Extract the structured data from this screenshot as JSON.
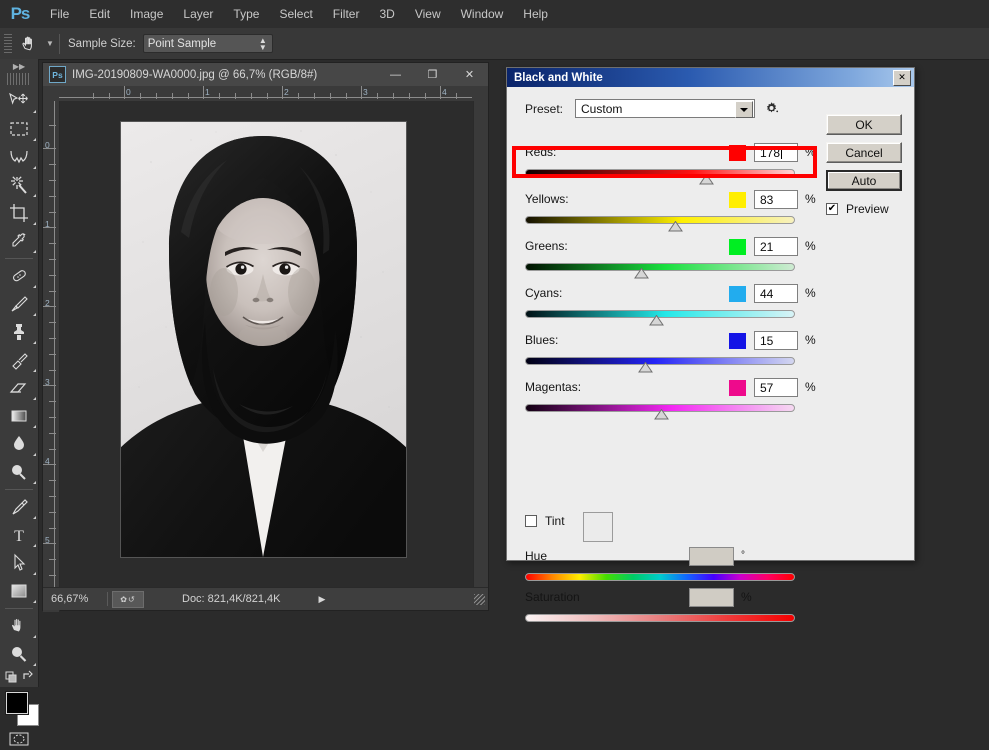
{
  "app": {
    "logo": "Ps",
    "menus": [
      "File",
      "Edit",
      "Image",
      "Layer",
      "Type",
      "Select",
      "Filter",
      "3D",
      "View",
      "Window",
      "Help"
    ]
  },
  "options_bar": {
    "tool_icon": "hand-tool-icon",
    "sample_size_label": "Sample Size:",
    "sample_size_value": "Point Sample"
  },
  "toolbar": {
    "tools": [
      {
        "name": "move-tool",
        "has_submenu": true
      },
      {
        "name": "rectangular-marquee-tool",
        "has_submenu": true
      },
      {
        "name": "lasso-tool",
        "has_submenu": true
      },
      {
        "name": "magic-wand-tool",
        "has_submenu": true
      },
      {
        "name": "crop-tool",
        "has_submenu": true
      },
      {
        "name": "eyedropper-tool",
        "has_submenu": true
      },
      {
        "name": "spot-healing-brush-tool",
        "has_submenu": true
      },
      {
        "name": "brush-tool",
        "has_submenu": true
      },
      {
        "name": "clone-stamp-tool",
        "has_submenu": true
      },
      {
        "name": "history-brush-tool",
        "has_submenu": true
      },
      {
        "name": "eraser-tool",
        "has_submenu": true
      },
      {
        "name": "gradient-tool",
        "has_submenu": true
      },
      {
        "name": "blur-tool",
        "has_submenu": true
      },
      {
        "name": "dodge-tool",
        "has_submenu": true
      },
      {
        "name": "pen-tool",
        "has_submenu": true
      },
      {
        "name": "horizontal-type-tool",
        "has_submenu": true
      },
      {
        "name": "path-selection-tool",
        "has_submenu": true
      },
      {
        "name": "rectangle-tool",
        "has_submenu": true
      },
      {
        "name": "hand-tool",
        "has_submenu": true
      },
      {
        "name": "zoom-tool",
        "has_submenu": true
      }
    ],
    "foreground_color": "#000000",
    "background_color": "#ffffff"
  },
  "document": {
    "title": "IMG-20190809-WA0000.jpg @ 66,7% (RGB/8#)",
    "icon": "Ps",
    "window_buttons": {
      "minimize": "—",
      "maximize": "❐",
      "close": "✕"
    },
    "ruler_h_marks": [
      "0",
      "1",
      "2",
      "3",
      "4"
    ],
    "ruler_v_marks": [
      "0",
      "1",
      "2",
      "3",
      "4",
      "5"
    ],
    "status": {
      "zoom": "66,67%",
      "doc_size": "Doc: 821,4K/821,4K",
      "arrow": "▶"
    },
    "image_description": "black-and-white-portrait-photo"
  },
  "dialog": {
    "title": "Black and White",
    "close_label": "✕",
    "preset_label": "Preset:",
    "preset_value": "Custom",
    "gear_icon": "gear-options-icon",
    "buttons": {
      "ok": "OK",
      "cancel": "Cancel",
      "auto": "Auto"
    },
    "preview": {
      "label": "Preview",
      "checked": true,
      "check_glyph": "✔"
    },
    "channels": [
      {
        "label": "Reds:",
        "value": "178",
        "unit": "%",
        "swatch": "#ff0000",
        "thumb_pct": 66.5,
        "from": "#100000",
        "mid": "#ff1414",
        "to": "#ffd4d4",
        "focused": true
      },
      {
        "label": "Yellows:",
        "value": "83",
        "unit": "%",
        "swatch": "#ffee00",
        "thumb_pct": 55.0,
        "from": "#121000",
        "mid": "#fff000",
        "to": "#fbf5c8",
        "focused": false
      },
      {
        "label": "Greens:",
        "value": "21",
        "unit": "%",
        "swatch": "#00ee22",
        "thumb_pct": 42.5,
        "from": "#001200",
        "mid": "#15e23c",
        "to": "#cdecd2",
        "focused": false
      },
      {
        "label": "Cyans:",
        "value": "44",
        "unit": "%",
        "swatch": "#22acee",
        "thumb_pct": 48.0,
        "from": "#001013",
        "mid": "#22e8e8",
        "to": "#d6f3f6",
        "focused": false
      },
      {
        "label": "Blues:",
        "value": "15",
        "unit": "%",
        "swatch": "#1414e6",
        "thumb_pct": 44.0,
        "from": "#000010",
        "mid": "#2323f5",
        "to": "#d2d5ef",
        "focused": false
      },
      {
        "label": "Magentas:",
        "value": "57",
        "unit": "%",
        "swatch": "#ee0a8c",
        "thumb_pct": 50.0,
        "from": "#100010",
        "mid": "#f225f2",
        "to": "#f3d6ef",
        "focused": false
      }
    ],
    "tint": {
      "label": "Tint",
      "checked": false,
      "swatch": "#ebebeb"
    },
    "hue": {
      "label": "Hue",
      "value": "",
      "unit": "°"
    },
    "saturation": {
      "label": "Saturation",
      "value": "",
      "unit": "%"
    },
    "annotation": {
      "name": "red-highlight-box",
      "color": "#fe0000"
    }
  }
}
